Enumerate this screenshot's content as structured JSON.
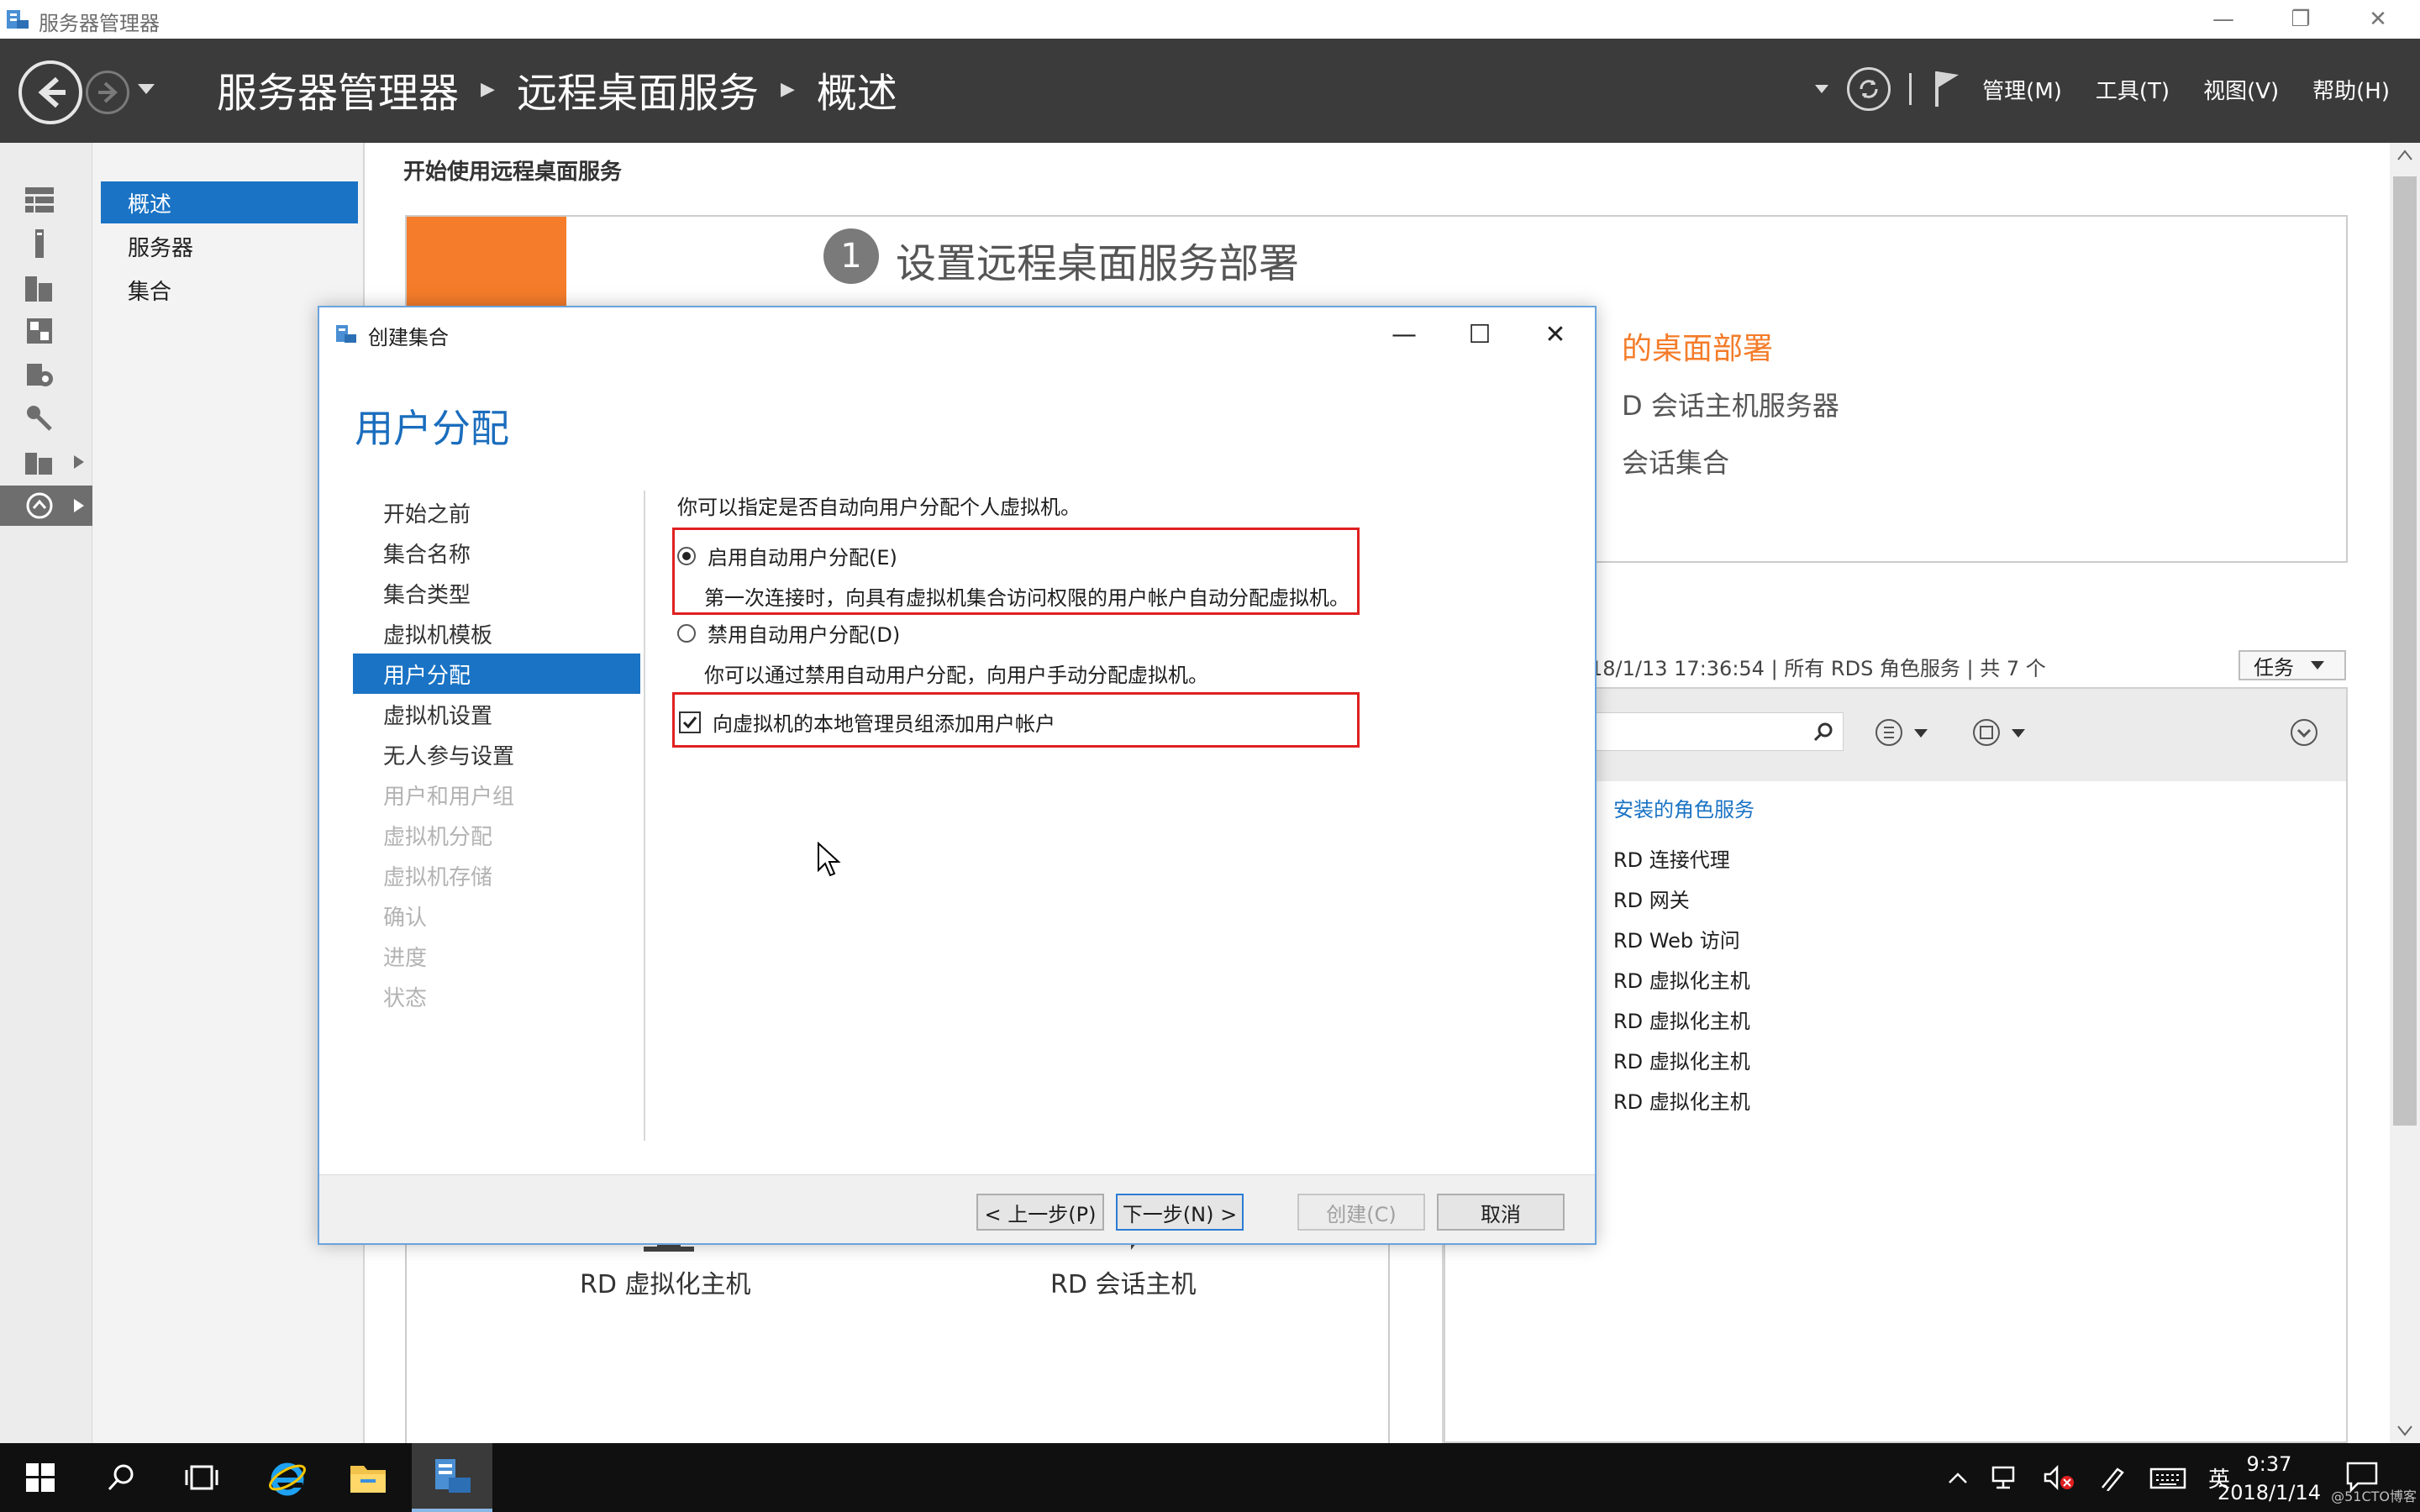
{
  "window": {
    "title": "服务器管理器"
  },
  "header": {
    "breadcrumb": [
      "服务器管理器",
      "远程桌面服务",
      "概述"
    ],
    "menu": [
      "管理(M)",
      "工具(T)",
      "视图(V)",
      "帮助(H)"
    ]
  },
  "nav": {
    "items": [
      "概述",
      "服务器",
      "集合"
    ],
    "selected_index": 0
  },
  "main": {
    "section_title": "开始使用远程桌面服务",
    "quickstart": {
      "step_number": "1",
      "step_title": "设置远程桌面服务部署",
      "link_partial": "的桌面部署",
      "line1_partial": "D 会话主机服务器",
      "line2_partial": "会话集合"
    },
    "deployment_line": "18/1/13 17:36:54 | 所有 RDS 角色服务 | 共 7 个",
    "tasks_label": "任务",
    "roles_header": "安装的角色服务",
    "roles": [
      "RD 连接代理",
      "RD 网关",
      "RD Web 访问",
      "RD 虚拟化主机",
      "RD 虚拟化主机",
      "RD 虚拟化主机",
      "RD 虚拟化主机"
    ],
    "bottom_labels": [
      "RD 虚拟化主机",
      "RD 会话主机"
    ]
  },
  "dialog": {
    "title": "创建集合",
    "heading": "用户分配",
    "steps": [
      {
        "label": "开始之前",
        "state": "normal"
      },
      {
        "label": "集合名称",
        "state": "normal"
      },
      {
        "label": "集合类型",
        "state": "normal"
      },
      {
        "label": "虚拟机模板",
        "state": "normal"
      },
      {
        "label": "用户分配",
        "state": "selected"
      },
      {
        "label": "虚拟机设置",
        "state": "normal"
      },
      {
        "label": "无人参与设置",
        "state": "normal"
      },
      {
        "label": "用户和用户组",
        "state": "disabled"
      },
      {
        "label": "虚拟机分配",
        "state": "disabled"
      },
      {
        "label": "虚拟机存储",
        "state": "disabled"
      },
      {
        "label": "确认",
        "state": "disabled"
      },
      {
        "label": "进度",
        "state": "disabled"
      },
      {
        "label": "状态",
        "state": "disabled"
      }
    ],
    "intro": "你可以指定是否自动向用户分配个人虚拟机。",
    "option_enable": {
      "label": "启用自动用户分配(E)",
      "description": "第一次连接时，向具有虚拟机集合访问权限的用户帐户自动分配虚拟机。",
      "selected": true
    },
    "option_disable": {
      "label": "禁用自动用户分配(D)",
      "description": "你可以通过禁用自动用户分配，向用户手动分配虚拟机。",
      "selected": false
    },
    "checkbox": {
      "label": "向虚拟机的本地管理员组添加用户帐户",
      "checked": true
    },
    "buttons": {
      "prev": "< 上一步(P)",
      "next": "下一步(N) >",
      "create": "创建(C)",
      "cancel": "取消"
    }
  },
  "taskbar": {
    "ime": "英",
    "time": "9:37",
    "date": "2018/1/14",
    "watermark": "@51CTO博客"
  },
  "colors": {
    "accent_blue": "#1a73c4",
    "header_dark": "#3b3b3b",
    "quickstart_orange": "#f47c2a",
    "highlight_red": "#e02020"
  }
}
